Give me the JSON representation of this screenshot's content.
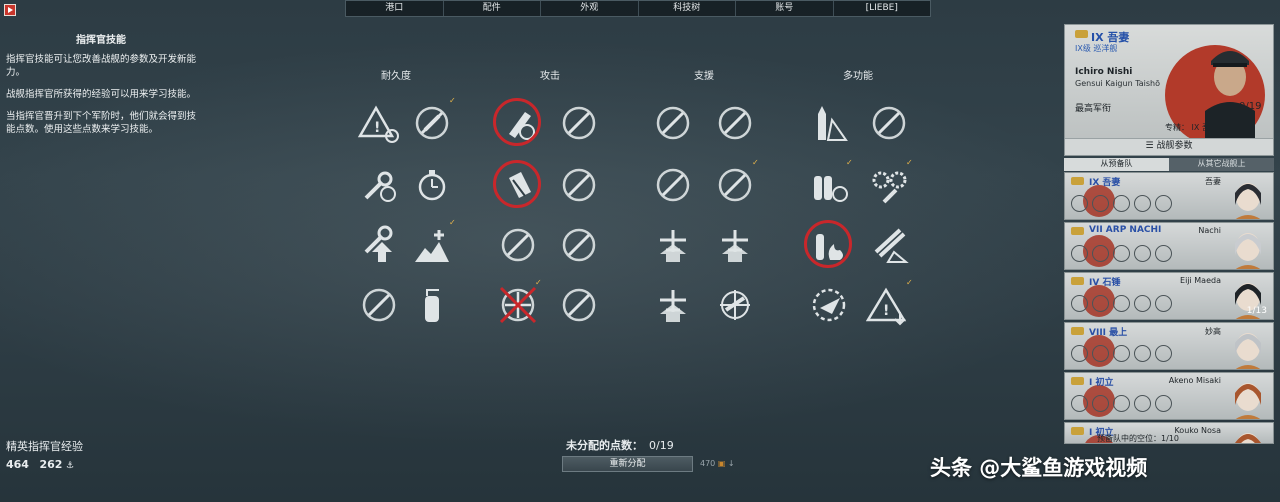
{
  "nav": {
    "tabs": [
      "港口",
      "配件",
      "外观",
      "科技树",
      "账号",
      "[LIEBE]"
    ]
  },
  "left_panel": {
    "title": "指挥官技能",
    "paragraphs": [
      "指挥官技能可让您改善战舰的参数及开发新能力。",
      "战舰指挥官所获得的经验可以用来学习技能。",
      "当指挥官晋升到下个军阶时，他们就会得到技能点数。使用这些点数来学习技能。"
    ]
  },
  "xp": {
    "label": "精英指挥官经验",
    "value1": "464",
    "value2": "262"
  },
  "columns": [
    "耐久度",
    "攻击",
    "支援",
    "多功能"
  ],
  "footer": {
    "unassigned_label": "未分配的点数：",
    "unassigned_value": "0/19",
    "reset_label": "重新分配",
    "reset_cost": "470"
  },
  "commander": {
    "tier": "IX 吾妻",
    "class": "IX级 巡洋舰",
    "name": "Ichiro Nishi",
    "rank_line": "Gensui Kaigun Taishō",
    "rank_title": "最高军衔",
    "points": "0/19",
    "spec_label": "专精：",
    "spec_value": "IX 吾妻",
    "stats_button": "战舰参数"
  },
  "selection_tabs": [
    "从预备队",
    "从其它战舰上"
  ],
  "roster": [
    {
      "ship": "IX 吾妻",
      "name": "吾妻",
      "points": ""
    },
    {
      "ship": "VII ARP NACHI",
      "name": "Nachi",
      "points": ""
    },
    {
      "ship": "IV 石锤",
      "name": "Eiji Maeda",
      "points": "1/13"
    },
    {
      "ship": "VIII 最上",
      "name": "妙高",
      "points": ""
    },
    {
      "ship": "I 初立",
      "name": "Akeno Misaki",
      "points": ""
    },
    {
      "ship": "I 初立",
      "name": "Kouko Nosa",
      "points": ""
    }
  ],
  "roster_footer": "预备队中的空位：1/10",
  "watermark": "头条 @大鲨鱼游戏视频",
  "colors": {
    "accent_red": "#c9272b",
    "check_gold": "#e7b54a",
    "tier_blue": "#2450a8"
  }
}
